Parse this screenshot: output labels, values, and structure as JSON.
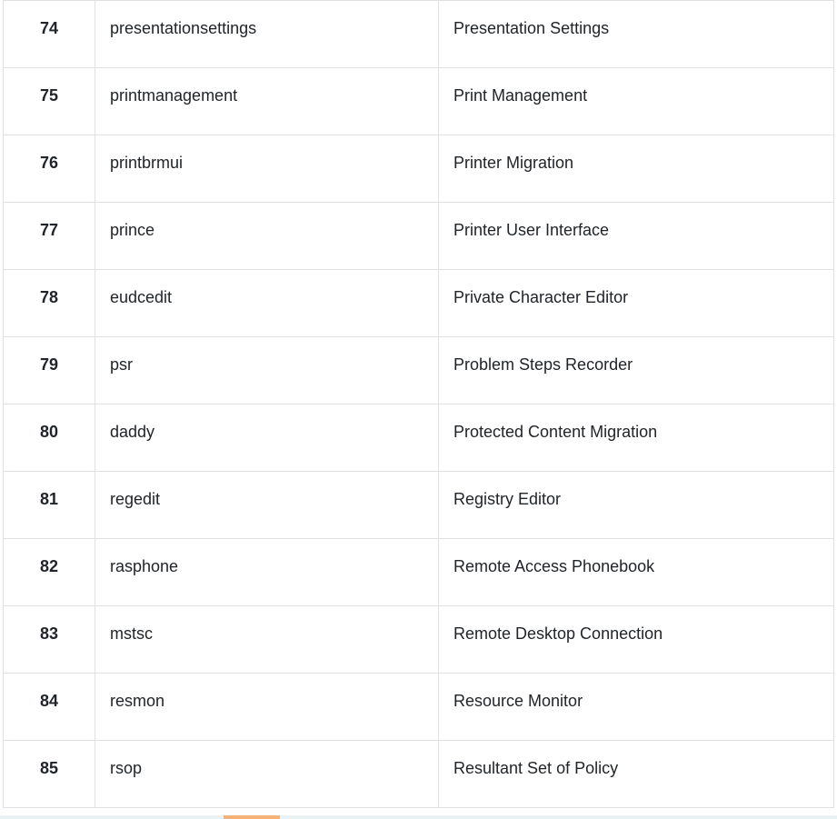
{
  "rows": [
    {
      "num": "74",
      "command": "presentationsettings",
      "name": "Presentation Settings"
    },
    {
      "num": "75",
      "command": "printmanagement",
      "name": "Print Management"
    },
    {
      "num": "76",
      "command": "printbrmui",
      "name": "Printer Migration"
    },
    {
      "num": "77",
      "command": "prince",
      "name": "Printer User Interface"
    },
    {
      "num": "78",
      "command": "eudcedit",
      "name": "Private Character Editor"
    },
    {
      "num": "79",
      "command": "psr",
      "name": "Problem Steps Recorder"
    },
    {
      "num": "80",
      "command": "daddy",
      "name": "Protected Content Migration"
    },
    {
      "num": "81",
      "command": "regedit",
      "name": "Registry Editor"
    },
    {
      "num": "82",
      "command": "rasphone",
      "name": "Remote Access Phonebook"
    },
    {
      "num": "83",
      "command": "mstsc",
      "name": "Remote Desktop Connection"
    },
    {
      "num": "84",
      "command": "resmon",
      "name": "Resource Monitor"
    },
    {
      "num": "85",
      "command": "rsop",
      "name": "Resultant Set of Policy"
    }
  ]
}
